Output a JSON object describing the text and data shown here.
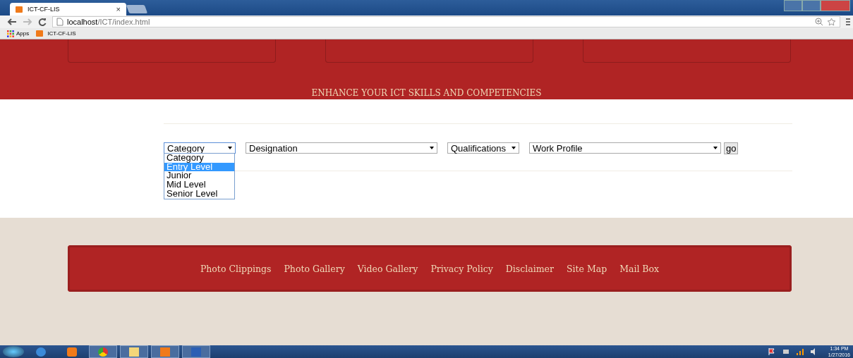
{
  "browser": {
    "tab_title": "ICT-CF-LIS",
    "tab_close": "×",
    "url_host": "localhost",
    "url_path": "/ICT/index.html",
    "bookmarks": [
      "Apps",
      "ICT-CF-LIS"
    ]
  },
  "banner": {
    "tagline": "ENHANCE YOUR ICT SKILLS AND COMPETENCIES"
  },
  "filters": [
    {
      "value": "Category",
      "expanded": true
    },
    {
      "value": "Designation",
      "expanded": false
    },
    {
      "value": "Qualifications",
      "expanded": false
    },
    {
      "value": "Work Profile",
      "expanded": false
    }
  ],
  "go_button": "go",
  "dropdown_options": [
    {
      "label": "Category",
      "selected": false
    },
    {
      "label": "Entry Level",
      "selected": true
    },
    {
      "label": "Junior",
      "selected": false
    },
    {
      "label": "Mid Level",
      "selected": false
    },
    {
      "label": "Senior Level",
      "selected": false
    }
  ],
  "footer_links": [
    "Photo Clippings",
    "Photo Gallery",
    "Video Gallery",
    "Privacy Policy",
    "Disclaimer",
    "Site Map",
    "Mail Box"
  ],
  "taskbar": {
    "time": "1:34 PM",
    "date": "1/27/2016"
  }
}
